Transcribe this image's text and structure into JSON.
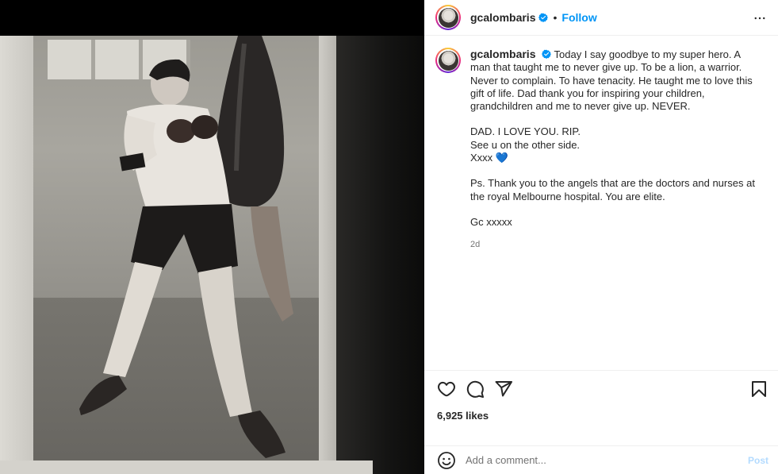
{
  "post": {
    "username": "gcalombaris",
    "follow_label": "Follow",
    "separator": "•",
    "caption_paragraphs": [
      "Today I say goodbye to my super hero. A man that taught me to never give up. To be a lion, a warrior. Never to complain. To have tenacity. He taught me to love this gift of life. Dad thank you for inspiring your children, grandchildren and me to never give up. NEVER.",
      "",
      "DAD. I LOVE YOU. RIP.",
      "See u on the other side.",
      "Xxxx",
      "",
      "Ps. Thank you to the angels that are the doctors and nurses at the royal Melbourne hospital. You are elite.",
      "",
      "Gc xxxxx"
    ],
    "heart_emoji": "💙",
    "time_ago": "2d",
    "likes": "6,925 likes"
  },
  "comment": {
    "placeholder": "Add a comment...",
    "post_label": "Post"
  },
  "colors": {
    "follow": "#0095f6",
    "verified": "#0095f6",
    "post_disabled": "#b3dbff",
    "muted": "#737373"
  },
  "icons": {
    "like": "heart-icon",
    "comment": "comment-icon",
    "share": "paper-plane-icon",
    "save": "bookmark-icon",
    "more": "more-horizontal-icon",
    "emoji": "emoji-icon",
    "verified": "verified-badge-icon"
  }
}
